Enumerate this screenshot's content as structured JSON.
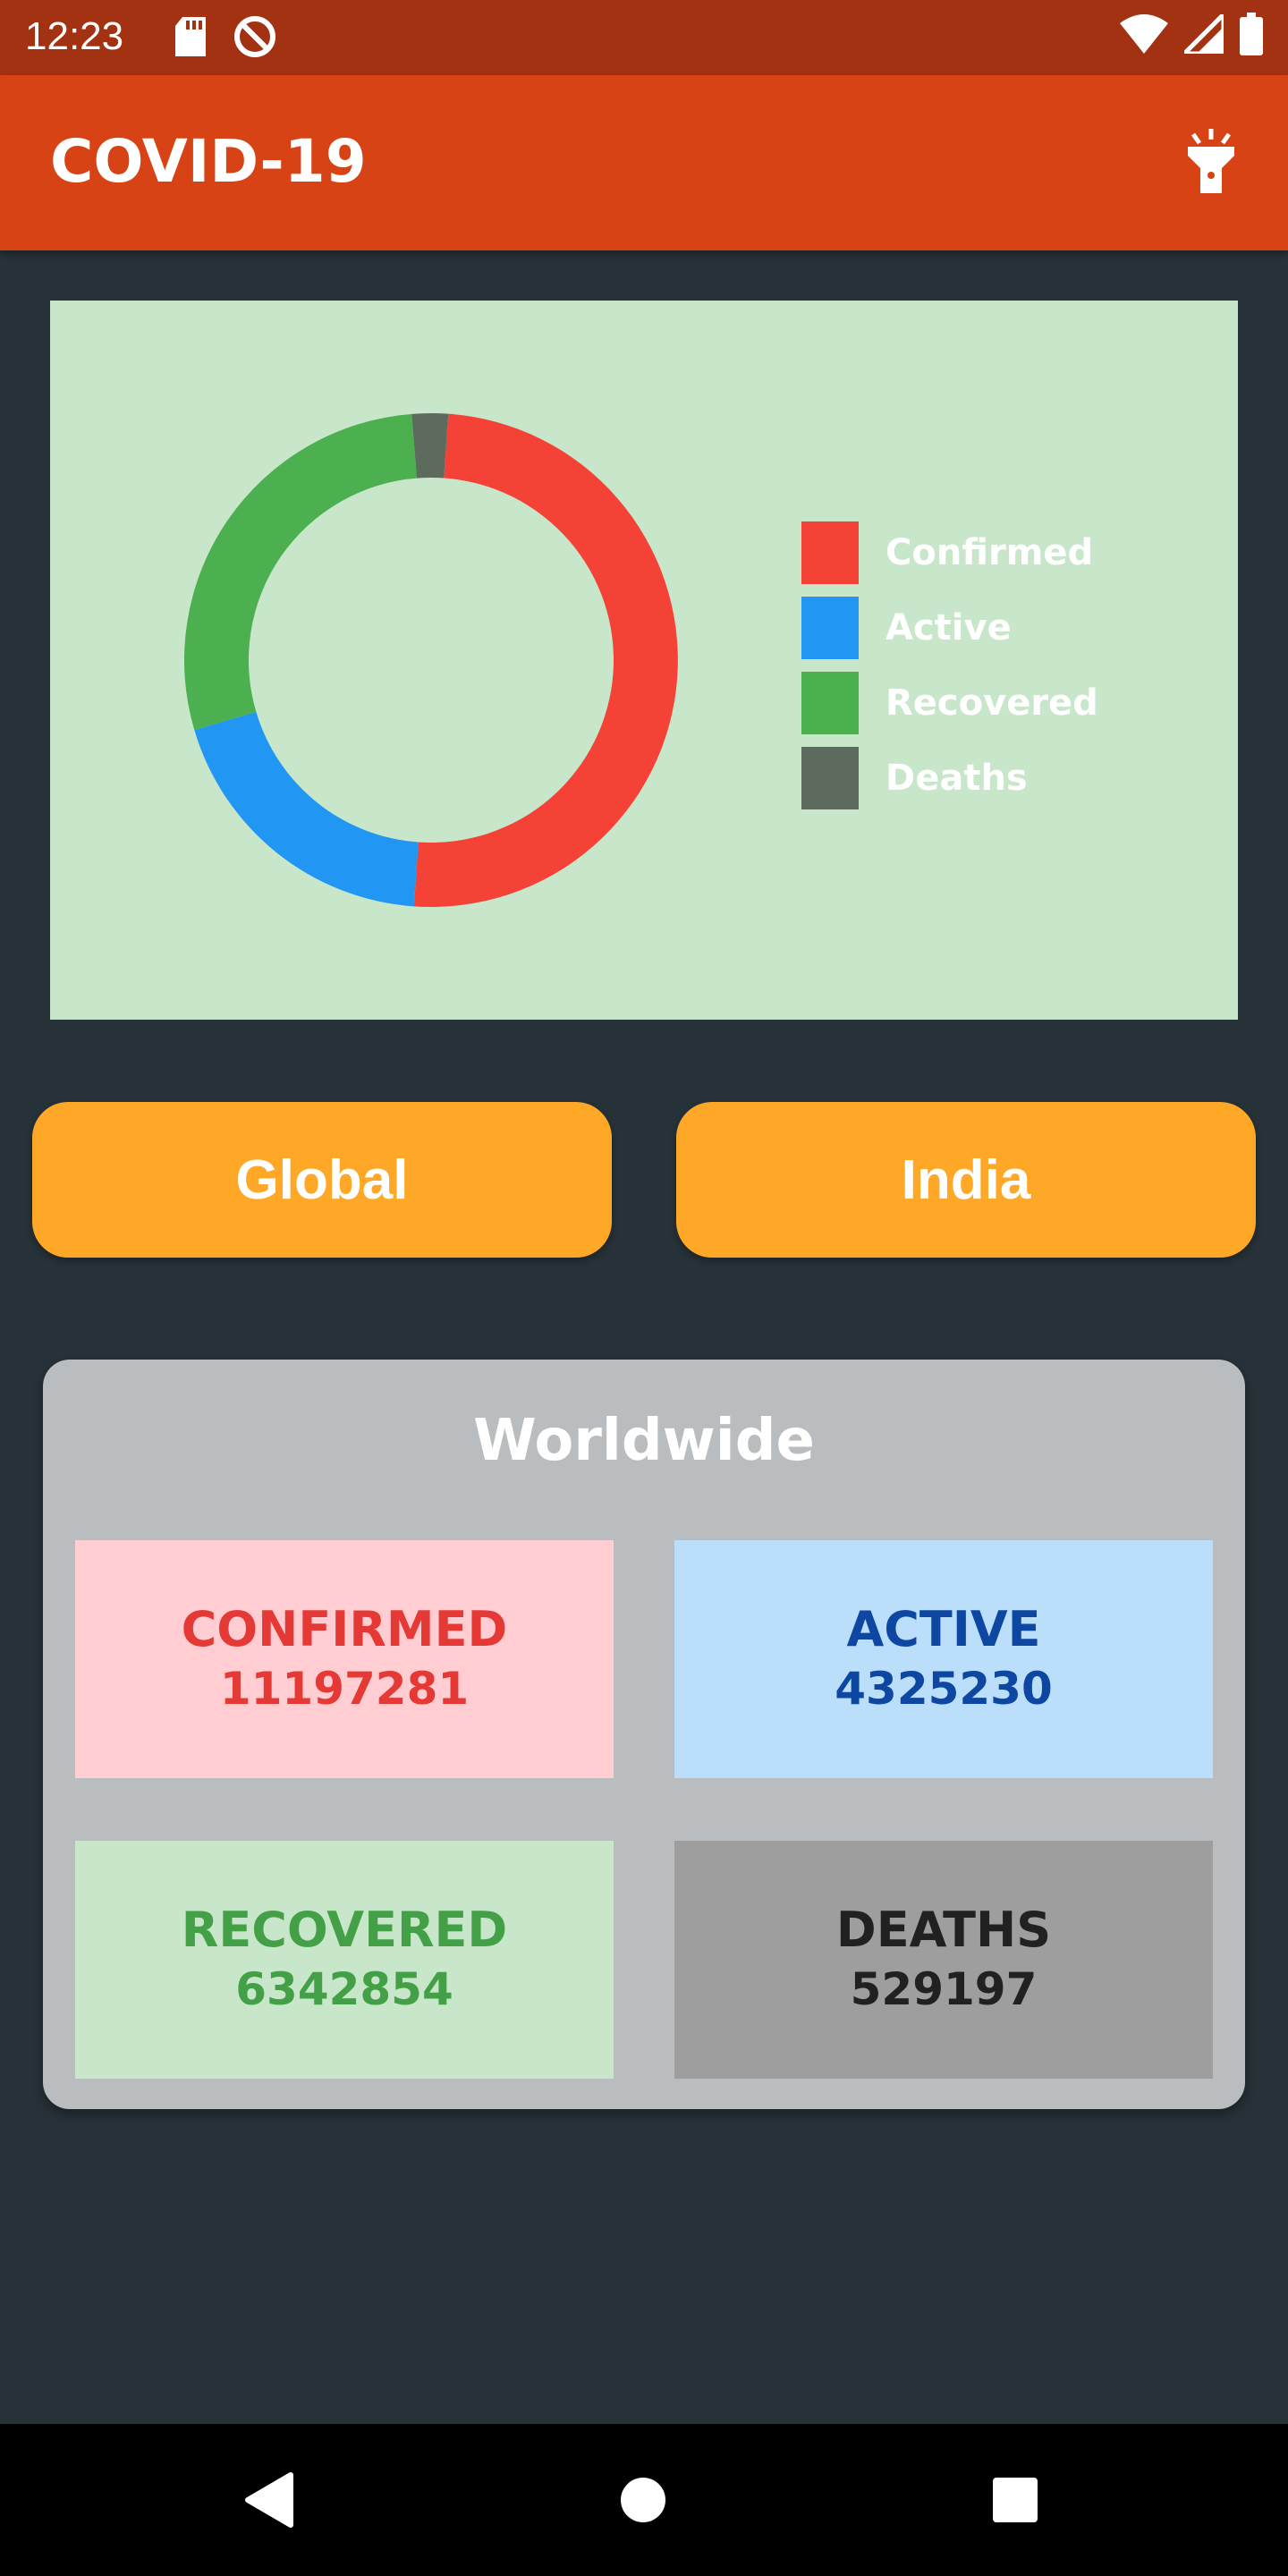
{
  "status_bar": {
    "time": "12:23",
    "icons_left": [
      "sd-card-icon",
      "no-disturb-icon"
    ],
    "icons_right": [
      "wifi-icon",
      "signal-icon",
      "battery-icon"
    ]
  },
  "app_bar": {
    "title": "COVID-19",
    "action_icon": "flashlight-icon"
  },
  "chart_data": {
    "type": "pie",
    "style": "donut",
    "categories": [
      "Confirmed",
      "Active",
      "Recovered",
      "Deaths"
    ],
    "values": [
      11197281,
      4325230,
      6342854,
      529197
    ],
    "colors": [
      "#F44336",
      "#2196F3",
      "#4CAF50",
      "#5D6B5F"
    ],
    "legend_placement": "right",
    "background": "#C8E6C9"
  },
  "buttons": {
    "global": "Global",
    "india": "India"
  },
  "stats": {
    "heading": "Worldwide",
    "confirmed": {
      "label": "CONFIRMED",
      "value": "11197281"
    },
    "active": {
      "label": "ACTIVE",
      "value": "4325230"
    },
    "recovered": {
      "label": "RECOVERED",
      "value": "6342854"
    },
    "deaths": {
      "label": "DEATHS",
      "value": "529197"
    }
  },
  "colors": {
    "status_bar": "#A33212",
    "app_bar": "#D84315",
    "page_bg": "#263238",
    "button": "#FFA726",
    "card": "#BABDBF"
  },
  "nav_bar": {
    "icons": [
      "back-icon",
      "home-icon",
      "recents-icon"
    ]
  }
}
